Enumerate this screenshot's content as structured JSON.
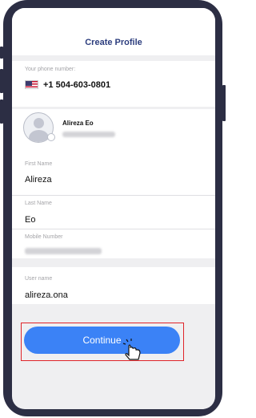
{
  "header": {
    "title": "Create Profile"
  },
  "phone": {
    "label": "Your phone number:",
    "value": "+1 504-603-0801",
    "flag_icon": "us-flag-icon"
  },
  "profile": {
    "name": "Alireza Eo",
    "phone_blurred": "+989012146293"
  },
  "form": {
    "first_name": {
      "label": "First Name",
      "value": "Alireza"
    },
    "last_name": {
      "label": "Last Name",
      "value": "Eo"
    },
    "mobile": {
      "label": "Mobile Number",
      "value_blurred": "+989012146293"
    },
    "username": {
      "label": "User name",
      "value": "alireza.ona"
    }
  },
  "actions": {
    "continue_label": "Continue",
    "pointer_icon": "hand-pointer-icon"
  },
  "colors": {
    "accent": "#3b82f6",
    "title": "#2d3e7e",
    "highlight": "#e0242a",
    "frame": "#2c2e44"
  }
}
